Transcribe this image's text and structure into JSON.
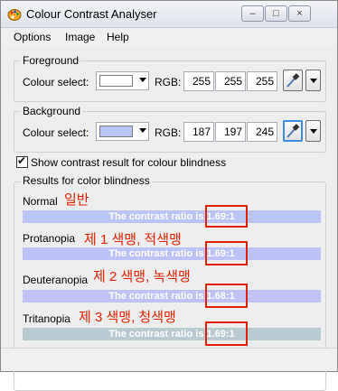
{
  "window": {
    "title": "Colour Contrast Analyser",
    "controls": [
      "–",
      "□",
      "×"
    ]
  },
  "menu": [
    "Options",
    "Image",
    "Help"
  ],
  "foreground": {
    "group_label": "Foreground",
    "colour_label": "Colour select:",
    "swatch_color": "#ffffff",
    "rgb_label": "RGB:",
    "r": "255",
    "g": "255",
    "b": "255"
  },
  "background": {
    "group_label": "Background",
    "colour_label": "Colour select:",
    "swatch_color": "#bbc5f5",
    "rgb_label": "RGB:",
    "r": "187",
    "g": "197",
    "b": "245"
  },
  "checkbox": {
    "label": "Show contrast result for colour blindness",
    "checked": true
  },
  "results": {
    "group_label": "Results for color blindness",
    "rows": [
      {
        "label": "Normal",
        "annotation": "일반",
        "text": "The contrast ratio is",
        "ratio": "1.69:1",
        "bar_color": "#bbc5f5"
      },
      {
        "label": "Protanopia",
        "annotation": "제 1 색맹, 적색맹",
        "text": "The contrast ratio is",
        "ratio": "1.69:1",
        "bar_color": "#bdc3f6"
      },
      {
        "label": "Deuteranopia",
        "annotation": "제 2 색맹, 녹색맹",
        "text": "The contrast ratio is",
        "ratio": "1.68:1",
        "bar_color": "#bec3f4"
      },
      {
        "label": "Tritanopia",
        "annotation": "제 3 색맹, 청색맹",
        "text": "The contrast ratio is",
        "ratio": "1.69:1",
        "bar_color": "#b9cbd0"
      }
    ]
  },
  "colors": {
    "annotation_red": "#e02000",
    "picker_active_border": "#3a8de0"
  },
  "icons": {
    "app": "palette-icon",
    "eyedropper": "eyedropper-icon"
  }
}
